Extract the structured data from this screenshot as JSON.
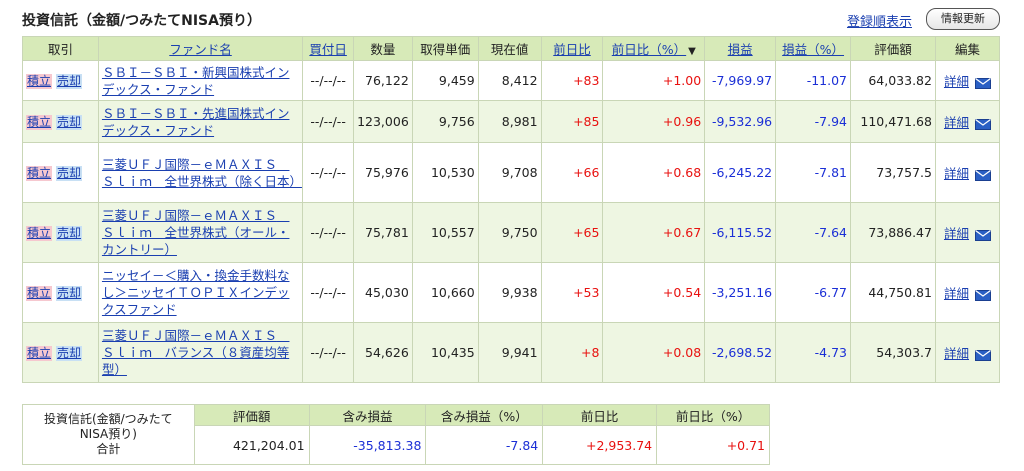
{
  "header": {
    "title": "投資信託（金額/つみたてNISA預り）",
    "sort_link": "登録順表示",
    "refresh_button": "情報更新"
  },
  "table": {
    "columns": {
      "trade": "取引",
      "fund_name": "ファンド名",
      "buy_date": "買付日",
      "quantity": "数量",
      "unit_price": "取得単価",
      "current_price": "現在値",
      "day_change": "前日比",
      "day_change_pct": "前日比（%）",
      "sort_indicator": "▼",
      "pl": "損益",
      "pl_pct": "損益（%）",
      "valuation": "評価額",
      "edit": "編集"
    },
    "buy_label": "積立",
    "sell_label": "売却",
    "detail_label": "詳細",
    "rows": [
      {
        "fund_name": "ＳＢＩ－ＳＢＩ・新興国株式インデックス・ファンド",
        "buy_date": "--/--/--",
        "quantity": "76,122",
        "unit_price": "9,459",
        "current_price": "8,412",
        "day_change": "+83",
        "day_change_pct": "+1.00",
        "pl": "-7,969.97",
        "pl_pct": "-11.07",
        "valuation": "64,033.82"
      },
      {
        "fund_name": "ＳＢＩ－ＳＢＩ・先進国株式インデックス・ファンド",
        "buy_date": "--/--/--",
        "quantity": "123,006",
        "unit_price": "9,756",
        "current_price": "8,981",
        "day_change": "+85",
        "day_change_pct": "+0.96",
        "pl": "-9,532.96",
        "pl_pct": "-7.94",
        "valuation": "110,471.68"
      },
      {
        "fund_name": "三菱ＵＦＪ国際－ｅＭＡＸＩＳ　Ｓｌｉｍ　全世界株式（除く日本）",
        "buy_date": "--/--/--",
        "quantity": "75,976",
        "unit_price": "10,530",
        "current_price": "9,708",
        "day_change": "+66",
        "day_change_pct": "+0.68",
        "pl": "-6,245.22",
        "pl_pct": "-7.81",
        "valuation": "73,757.5"
      },
      {
        "fund_name": "三菱ＵＦＪ国際－ｅＭＡＸＩＳ　Ｓｌｉｍ　全世界株式（オール・カントリー）",
        "buy_date": "--/--/--",
        "quantity": "75,781",
        "unit_price": "10,557",
        "current_price": "9,750",
        "day_change": "+65",
        "day_change_pct": "+0.67",
        "pl": "-6,115.52",
        "pl_pct": "-7.64",
        "valuation": "73,886.47"
      },
      {
        "fund_name": "ニッセイ－＜購入・換金手数料なし＞ニッセイＴＯＰＩＸインデックスファンド",
        "buy_date": "--/--/--",
        "quantity": "45,030",
        "unit_price": "10,660",
        "current_price": "9,938",
        "day_change": "+53",
        "day_change_pct": "+0.54",
        "pl": "-3,251.16",
        "pl_pct": "-6.77",
        "valuation": "44,750.81"
      },
      {
        "fund_name": "三菱ＵＦＪ国際－ｅＭＡＸＩＳ　Ｓｌｉｍ　バランス（８資産均等型）",
        "buy_date": "--/--/--",
        "quantity": "54,626",
        "unit_price": "10,435",
        "current_price": "9,941",
        "day_change": "+8",
        "day_change_pct": "+0.08",
        "pl": "-2,698.52",
        "pl_pct": "-4.73",
        "valuation": "54,303.7"
      }
    ]
  },
  "summary": {
    "label_line1": "投資信託(金額/つみたて",
    "label_line2": "NISA預り)",
    "label_line3": "合計",
    "columns": {
      "valuation": "評価額",
      "unrealized_pl": "含み損益",
      "unrealized_pl_pct": "含み損益（%）",
      "day_change": "前日比",
      "day_change_pct": "前日比（%）"
    },
    "values": {
      "valuation": "421,204.01",
      "unrealized_pl": "-35,813.38",
      "unrealized_pl_pct": "-7.84",
      "day_change": "+2,953.74",
      "day_change_pct": "+0.71"
    }
  },
  "colors": {
    "header_bg": "#d7eab8",
    "alt_row_bg": "#eef6e2",
    "positive": "#e8110f",
    "negative": "#1b2fd6",
    "link": "#1a3fb0"
  },
  "icons": {
    "mail": "mail-icon"
  }
}
